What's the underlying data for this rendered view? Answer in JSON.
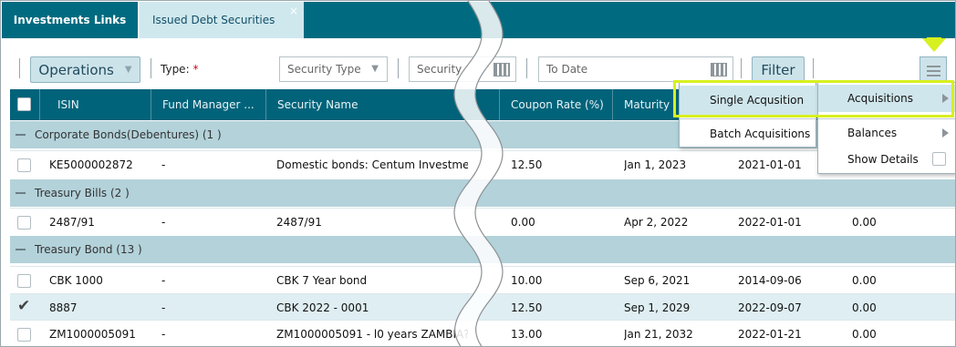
{
  "tabs": {
    "investments_links": "Investments Links",
    "issued_debt_securities": "Issued Debt Securities",
    "close_glyph": "×"
  },
  "toolbar": {
    "operations_label": "Operations",
    "type_label": "Type:",
    "required_mark": "*",
    "security_type_placeholder": "Security Type",
    "security_placeholder": "Security",
    "to_date_placeholder": "To Date",
    "filter_label": "Filter"
  },
  "grid": {
    "headers": [
      "ISIN",
      "Fund Manager ...",
      "Security Name",
      "Coupon Rate (%)",
      "Maturity"
    ],
    "groups": [
      {
        "label": "Corporate Bonds(Debentures) (1 )",
        "rows": [
          {
            "isin": "KE5000002872",
            "fund_manager": "-",
            "security_name": "Domestic bonds: Centum Investme",
            "coupon": "12.50",
            "maturity": "Jan 1, 2023",
            "issue_date": "2021-01-01",
            "extra": ""
          }
        ]
      },
      {
        "label": "Treasury Bills (2 )",
        "rows": [
          {
            "isin": "2487/91",
            "fund_manager": "-",
            "security_name": "2487/91",
            "coupon": "0.00",
            "maturity": "Apr 2, 2022",
            "issue_date": "2022-01-01",
            "extra": "0.00"
          }
        ]
      },
      {
        "label": "Treasury Bond (13 )",
        "rows": [
          {
            "isin": "CBK 1000",
            "fund_manager": "-",
            "security_name": "CBK 7 Year bond",
            "coupon": "10.00",
            "maturity": "Sep 6, 2021",
            "issue_date": "2014-09-06",
            "extra": "0.00"
          },
          {
            "isin": "8887",
            "fund_manager": "-",
            "security_name": "CBK 2022 - 0001",
            "coupon": "12.50",
            "maturity": "Sep 1, 2029",
            "issue_date": "2022-09-07",
            "extra": "0.00",
            "checked": true
          },
          {
            "isin": "ZM1000005091",
            "fund_manager": "-",
            "security_name": "ZM1000005091 - l0 years ZAMBIA?",
            "coupon": "13.00",
            "maturity": "Jan 21, 2032",
            "issue_date": "2022-01-21",
            "extra": "0.00"
          }
        ]
      }
    ]
  },
  "menus": {
    "operations_submenu": {
      "single_acquisition": "Single Acqusition",
      "batch_acquisitions": "Batch Acquisitions"
    },
    "main_menu": {
      "acquisitions": "Acquisitions",
      "balances": "Balances",
      "show_details": "Show Details"
    }
  },
  "colors": {
    "header_teal": "#00637a",
    "tab_bar": "#006b80",
    "group_row": "#b3d2da",
    "highlight": "#d7f01f"
  },
  "icons": {
    "check": "✔"
  }
}
